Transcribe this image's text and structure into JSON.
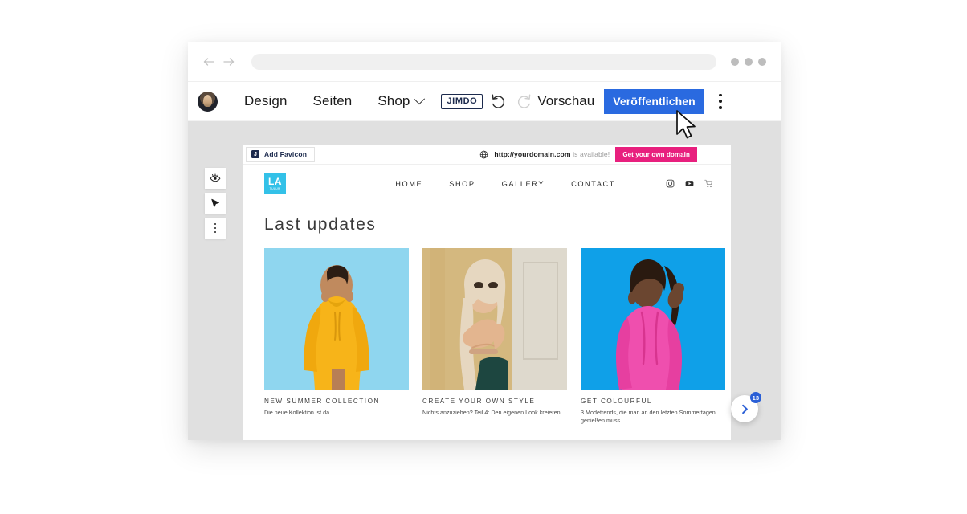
{
  "browser": {
    "back_icon": "back-arrow-icon",
    "forward_icon": "forward-arrow-icon",
    "url_value": "",
    "url_placeholder": "",
    "window_dots": 3
  },
  "editor_bar": {
    "avatar_alt": "user-avatar",
    "menu": [
      {
        "label": "Design",
        "has_chevron": false
      },
      {
        "label": "Seiten",
        "has_chevron": false
      },
      {
        "label": "Shop",
        "has_chevron": true
      }
    ],
    "brand_logo": "JIMDO",
    "undo_icon": "undo-icon",
    "redo_icon": "redo-icon",
    "preview_label": "Vorschau",
    "publish_label": "Veröffentlichen",
    "publish_color": "#2a6ae0",
    "overflow_icon": "kebab-menu-icon"
  },
  "left_tools": [
    {
      "name": "preview-eye-icon"
    },
    {
      "name": "cursor-pointer-icon"
    },
    {
      "name": "more-options-icon"
    }
  ],
  "favicon_bar": {
    "favicon_button_label": "Add Favicon",
    "favicon_glyph": "J",
    "globe_icon": "globe-icon",
    "domain_name": "http://yourdomain.com",
    "domain_status": " is available!",
    "domain_cta_label": "Get your own domain",
    "domain_cta_color": "#e8207e"
  },
  "site": {
    "logo_main": "LA",
    "logo_sub": "TULUM",
    "logo_color": "#33c1e8",
    "nav_links": [
      "HOME",
      "SHOP",
      "GALLERY",
      "CONTACT"
    ],
    "nav_icons": [
      "instagram-icon",
      "youtube-icon",
      "cart-icon"
    ],
    "heading": "Last updates",
    "cards": [
      {
        "title": "NEW SUMMER COLLECTION",
        "desc": "Die neue Kollektion ist da",
        "image_alt": "woman-in-yellow-hoodie-on-light-blue-background",
        "bg": "#8fd6ef",
        "garment": "#f7b419"
      },
      {
        "title": "CREATE YOUR OWN STYLE",
        "desc": "Nichts anzuziehen? Teil 4: Den eigenen Look kreieren",
        "image_alt": "blonde-woman-against-yellow-wall",
        "bg": "#d9c08a",
        "garment": "#1d4640"
      },
      {
        "title": "GET COLOURFUL",
        "desc": "3 Modetrends, die man an den letzten Sommertagen genießen muss",
        "image_alt": "woman-in-pink-outfit-on-blue-background",
        "bg": "#0fa0e8",
        "garment": "#ef4fae"
      }
    ],
    "bottom_bars": [
      {
        "color": "#1f9fbd"
      },
      {
        "color": "#9f91c0"
      }
    ]
  },
  "chat_widget": {
    "icon": "chevron-right-icon",
    "badge_count": "13",
    "badge_color": "#2a5fd6"
  },
  "cursor": {
    "icon": "mouse-pointer-icon"
  }
}
